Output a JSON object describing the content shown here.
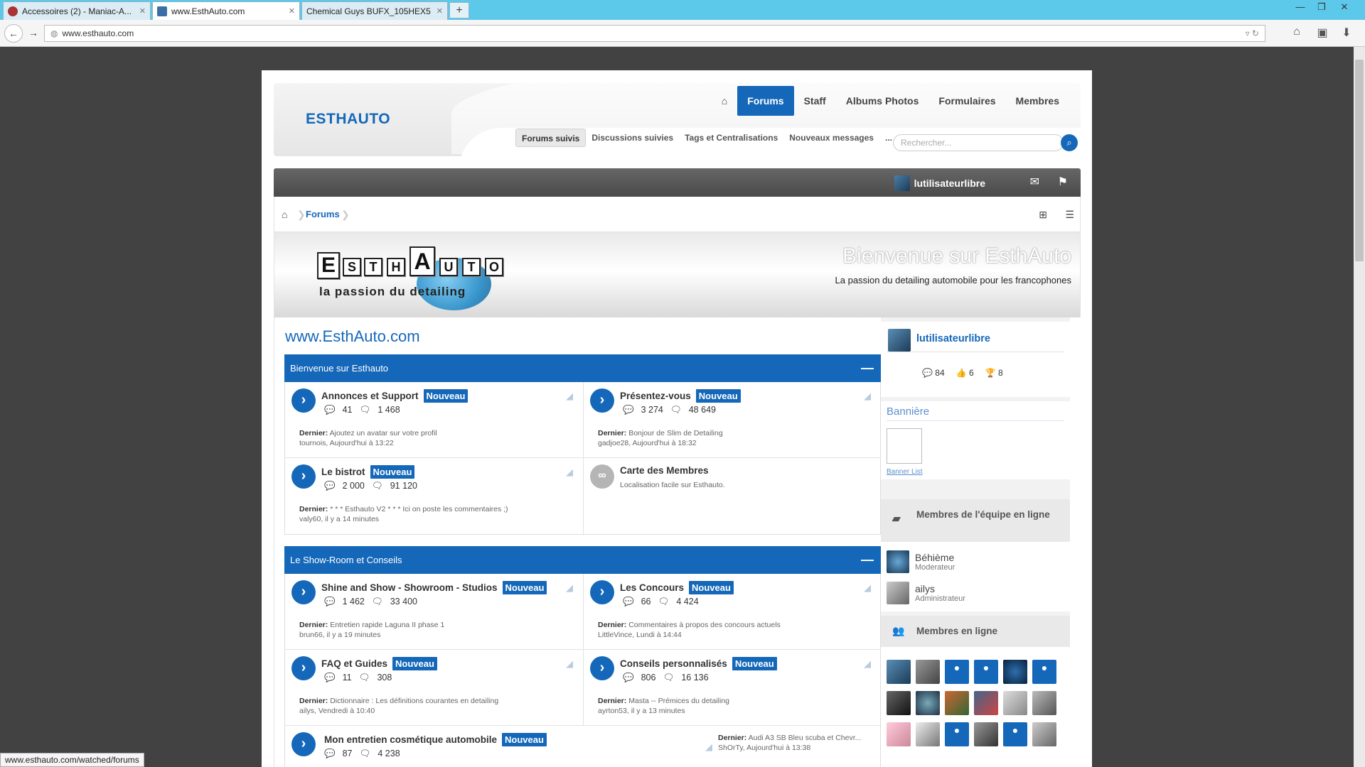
{
  "browser": {
    "tabs": [
      {
        "label": "Accessoires (2) - Maniac-A...",
        "active": false
      },
      {
        "label": "www.EsthAuto.com",
        "active": true
      },
      {
        "label": "Chemical Guys BUFX_105HEX5 ...",
        "active": false
      }
    ],
    "new_tab": "+",
    "url": "www.esthauto.com",
    "status_url": "www.esthauto.com/watched/forums"
  },
  "header": {
    "logo": "ESTHAUTO",
    "nav": [
      "Forums",
      "Staff",
      "Albums Photos",
      "Formulaires",
      "Membres"
    ],
    "subnav": [
      "Forums suivis",
      "Discussions suivies",
      "Tags et Centralisations",
      "Nouveaux messages",
      "..."
    ],
    "search_placeholder": "Rechercher..."
  },
  "userbar": {
    "username": "lutilisateurlibre"
  },
  "breadcrumb": {
    "forums": "Forums"
  },
  "banner": {
    "letters": [
      "E",
      "S",
      "T",
      "H",
      "A",
      "U",
      "T",
      "O"
    ],
    "slogan": "la passion du detailing",
    "title": "Bienvenue sur EsthAuto",
    "subtitle": "La passion du detailing automobile pour les francophones"
  },
  "site_title": "www.EsthAuto.com",
  "categories": [
    {
      "title": "Bienvenue sur Esthauto",
      "collapse": "—",
      "nodes": [
        {
          "title": "Annonces et Support",
          "badge": "Nouveau",
          "discussions": "41",
          "messages": "1 468",
          "last_label": "Dernier:",
          "last_title": "Ajoutez un avatar sur votre profil",
          "last_meta": "tournois, Aujourd'hui à 13:22"
        },
        {
          "title": "Présentez-vous",
          "badge": "Nouveau",
          "discussions": "3 274",
          "messages": "48 649",
          "last_label": "Dernier:",
          "last_title": "Bonjour de Slim de Detailing",
          "last_meta": "gadjoe28, Aujourd'hui à 18:32"
        },
        {
          "title": "Le bistrot",
          "badge": "Nouveau",
          "discussions": "2 000",
          "messages": "91 120",
          "last_label": "Dernier:",
          "last_title": "* * * Esthauto V2 * * * Ici on poste les commentaires ;)",
          "last_meta": "valy60, il y a 14 minutes"
        },
        {
          "title": "Carte des Membres",
          "desc": "Localisation facile sur Esthauto."
        }
      ]
    },
    {
      "title": "Le Show-Room et Conseils",
      "collapse": "—",
      "nodes": [
        {
          "title": "Shine and Show - Showroom - Studios",
          "badge": "Nouveau",
          "discussions": "1 462",
          "messages": "33 400",
          "last_label": "Dernier:",
          "last_title": "Entretien rapide Laguna II phase 1",
          "last_meta": "brun66, il y a 19 minutes"
        },
        {
          "title": "Les Concours",
          "badge": "Nouveau",
          "discussions": "66",
          "messages": "4 424",
          "last_label": "Dernier:",
          "last_title": "Commentaires à propos des concours actuels",
          "last_meta": "LittleVince, Lundi à 14:44"
        },
        {
          "title": "FAQ et Guides",
          "badge": "Nouveau",
          "discussions": "11",
          "messages": "308",
          "last_label": "Dernier:",
          "last_title": "Dictionnaire : Les définitions courantes en detailing",
          "last_meta": "ailys, Vendredi à 10:40"
        },
        {
          "title": "Conseils personnalisés",
          "badge": "Nouveau",
          "discussions": "806",
          "messages": "16 136",
          "last_label": "Dernier:",
          "last_title": "Masta -- Prémices du detailing",
          "last_meta": "ayrton53, il y a 13 minutes"
        },
        {
          "title": "Mon entretien cosmétique automobile",
          "badge": "Nouveau",
          "discussions": "87",
          "messages": "4 238",
          "last_label": "Dernier:",
          "last_title": "Audi A3 SB Bleu scuba et Chevr...",
          "last_meta": "ShOrTy, Aujourd'hui à 13:38"
        }
      ]
    }
  ],
  "sidebar": {
    "user": {
      "name": "lutilisateurlibre",
      "messages": "84",
      "likes": "6",
      "trophies": "8"
    },
    "banner_title": "Bannière",
    "banner_link": "Banner List",
    "staff_title": "Membres de l'équipe en ligne",
    "staff": [
      {
        "name": "Béhième",
        "role": "Moderateur"
      },
      {
        "name": "ailys",
        "role": "Administrateur"
      }
    ],
    "online_title": "Membres en ligne"
  }
}
